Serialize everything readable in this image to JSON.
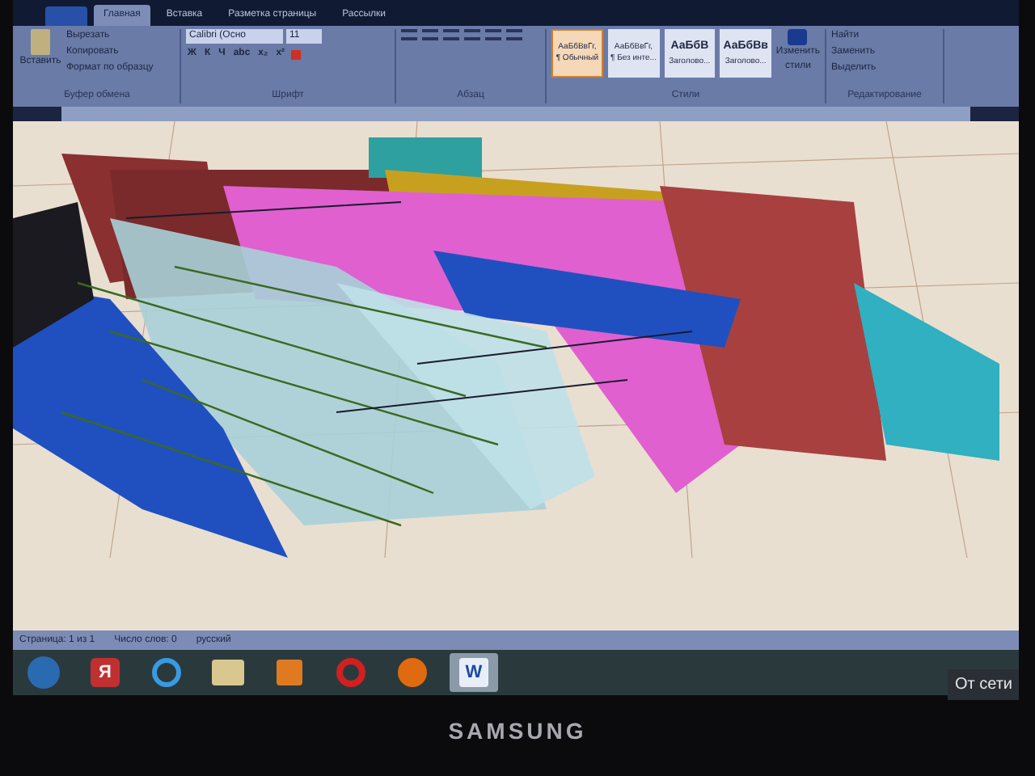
{
  "ribbon": {
    "tabs": [
      {
        "label": "Главная",
        "selected": true
      },
      {
        "label": "Вставка",
        "selected": false
      },
      {
        "label": "Разметка страницы",
        "selected": false
      },
      {
        "label": "Рассылки",
        "selected": false
      }
    ],
    "clipboard": {
      "paste": "Вставить",
      "items": [
        "Вырезать",
        "Копировать",
        "Формат по образцу"
      ],
      "group": "Буфер обмена"
    },
    "font": {
      "family": "Calibri (Осно",
      "size": "11",
      "format_buttons": [
        "Ж",
        "К",
        "Ч",
        "abc",
        "x₂",
        "x²"
      ],
      "group": "Шрифт"
    },
    "paragraph": {
      "group": "Абзац"
    },
    "styles": {
      "items": [
        {
          "sample": "АаБбВвГг,",
          "name": "¶ Обычный",
          "selected": true
        },
        {
          "sample": "АаБбВвГг,",
          "name": "¶ Без инте...",
          "selected": false
        },
        {
          "sample": "АаБбВ",
          "name": "Заголово...",
          "selected": false
        },
        {
          "sample": "АаБбВв",
          "name": "Заголово...",
          "selected": false
        }
      ],
      "change": "Изменить стили",
      "group": "Стили"
    },
    "editing": {
      "items": [
        "Найти",
        "Заменить",
        "Выделить"
      ],
      "group": "Редактирование"
    }
  },
  "status_bar": {
    "page": "Страница: 1 из 1",
    "words": "Число слов: 0",
    "language": "русский"
  },
  "taskbar": {
    "apps": [
      {
        "kind": "start",
        "selected": false
      },
      {
        "kind": "yandex",
        "label": "Я",
        "selected": false
      },
      {
        "kind": "ie",
        "selected": false
      },
      {
        "kind": "explorer",
        "selected": false
      },
      {
        "kind": "media",
        "selected": false
      },
      {
        "kind": "opera",
        "selected": false
      },
      {
        "kind": "firefox",
        "selected": false
      },
      {
        "kind": "word",
        "label": "W",
        "selected": true
      }
    ]
  },
  "tooltip": "От сети",
  "brand": "SAMSUNG"
}
